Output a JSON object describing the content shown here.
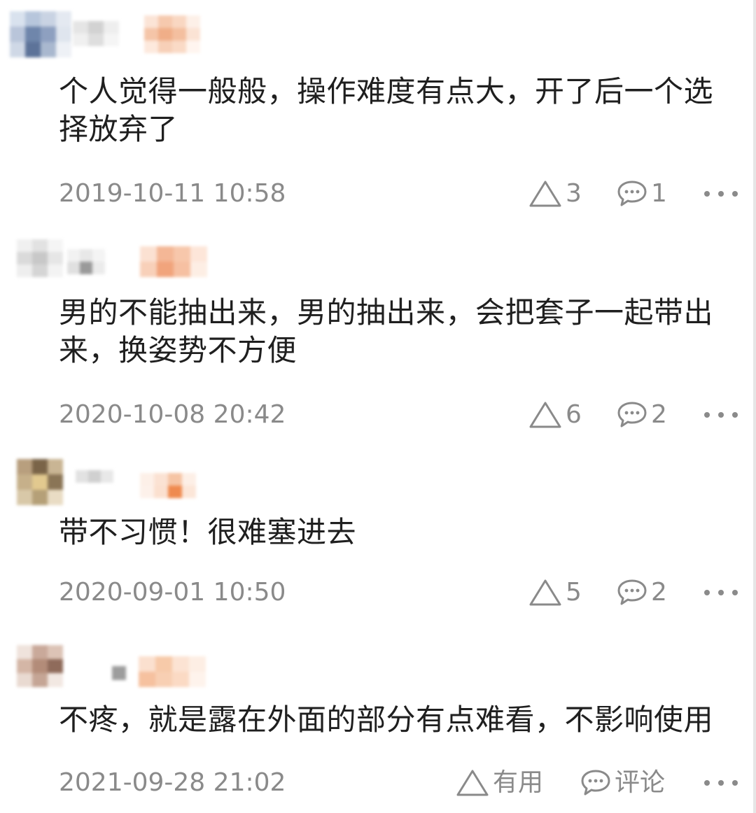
{
  "comments": [
    {
      "text": "个人觉得一般般，操作难度有点大，开了后一个选择放弃了",
      "timestamp": "2019-10-11 10:58",
      "like_count": "3",
      "reply_count": "1"
    },
    {
      "text": "男的不能抽出来，男的抽出来，会把套子一起带出来，换姿势不方便",
      "timestamp": "2020-10-08 20:42",
      "like_count": "6",
      "reply_count": "2"
    },
    {
      "text": "带不习惯！很难塞进去",
      "timestamp": "2020-09-01 10:50",
      "like_count": "5",
      "reply_count": "2"
    },
    {
      "text": "不疼，就是露在外面的部分有点难看，不影响使用",
      "timestamp": "2021-09-28 21:02",
      "like_label": "有用",
      "reply_label": "评论"
    }
  ],
  "icons": {
    "like": "triangle-outline-icon",
    "reply": "speech-bubble-icon",
    "more": "more-dots-icon"
  },
  "colors": {
    "text": "#1f1f1f",
    "meta": "#8a8a8a",
    "background": "#ffffff"
  }
}
